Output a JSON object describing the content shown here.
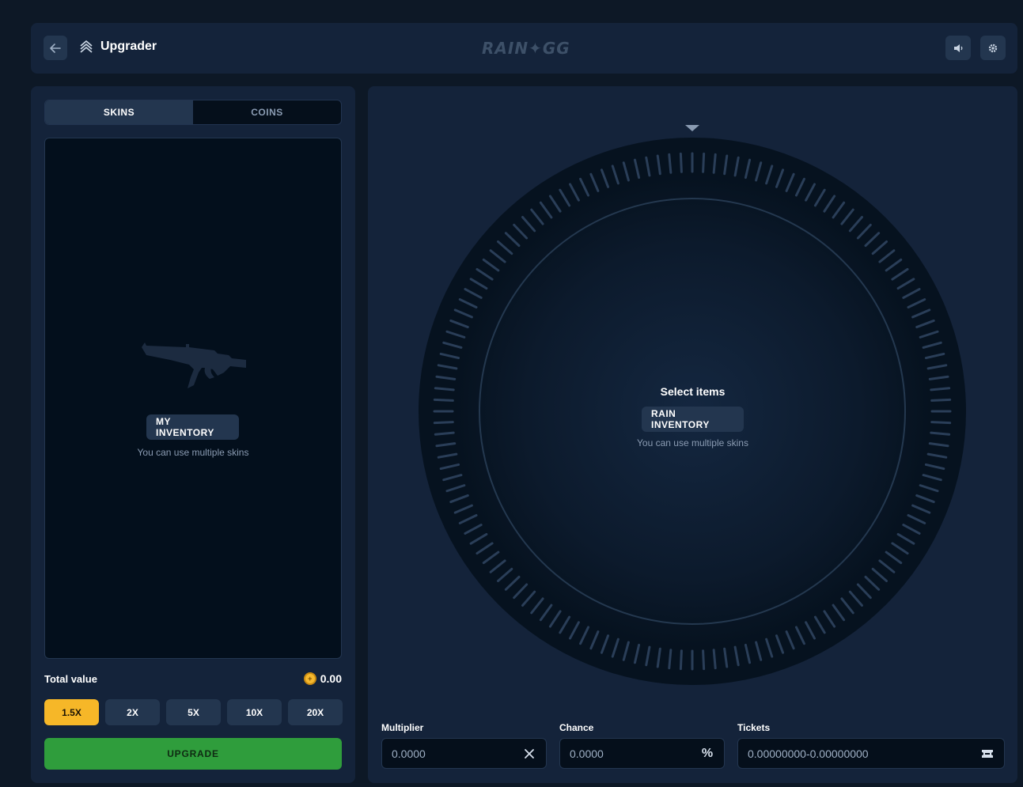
{
  "header": {
    "title": "Upgrader",
    "logo_text": "RAIN✦GG"
  },
  "left": {
    "tabs": [
      {
        "label": "SKINS",
        "active": true
      },
      {
        "label": "COINS",
        "active": false
      }
    ],
    "inventory_button": "MY INVENTORY",
    "inventory_hint": "You can use multiple skins",
    "total_label": "Total value",
    "total_value": "0.00",
    "multipliers": [
      "1.5X",
      "2X",
      "5X",
      "10X",
      "20X"
    ],
    "active_multiplier": "1.5X",
    "upgrade_label": "UPGRADE"
  },
  "right": {
    "select_title": "Select items",
    "rain_button": "RAIN INVENTORY",
    "rain_hint": "You can use multiple skins",
    "fields": {
      "multiplier": {
        "label": "Multiplier",
        "value": "0.0000"
      },
      "chance": {
        "label": "Chance",
        "value": "0.0000",
        "suffix": "%"
      },
      "tickets": {
        "label": "Tickets",
        "value": "0.00000000-0.00000000"
      }
    }
  },
  "colors": {
    "accent_yellow": "#f6b728",
    "upgrade_green": "#2f9d3c",
    "panel": "#14233a",
    "background": "#0d1826"
  }
}
